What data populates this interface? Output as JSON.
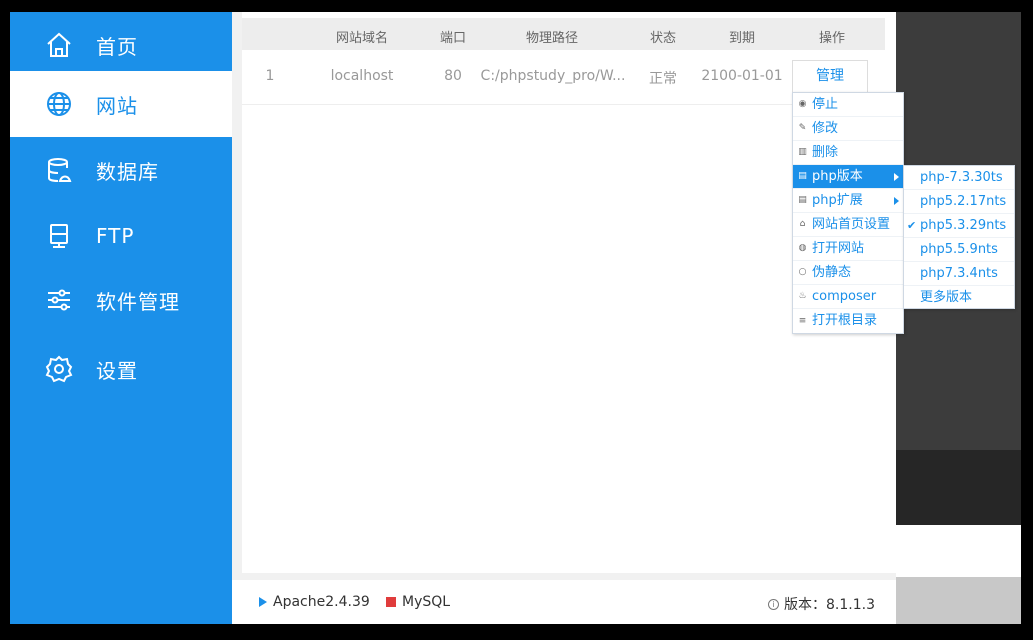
{
  "sidebar": {
    "items": [
      {
        "label": "首页",
        "icon": "home-icon"
      },
      {
        "label": "网站",
        "icon": "globe-icon",
        "active": true
      },
      {
        "label": "数据库",
        "icon": "database-icon"
      },
      {
        "label": "FTP",
        "icon": "ftp-icon"
      },
      {
        "label": "软件管理",
        "icon": "sliders-icon"
      },
      {
        "label": "设置",
        "icon": "gear-icon"
      }
    ]
  },
  "table": {
    "headers": [
      "网站域名",
      "端口",
      "物理路径",
      "状态",
      "到期",
      "操作"
    ],
    "rows": [
      {
        "index": "1",
        "domain": "localhost",
        "port": "80",
        "path": "C:/phpstudy_pro/W...",
        "status": "正常",
        "expiry": "2100-01-01",
        "action": "管理"
      }
    ]
  },
  "context_menu": {
    "items": [
      {
        "label": "停止",
        "icon": "stop-icon"
      },
      {
        "label": "修改",
        "icon": "edit-icon"
      },
      {
        "label": "删除",
        "icon": "trash-icon"
      },
      {
        "label": "php版本",
        "icon": "php-version-icon",
        "active": true,
        "has_submenu": true
      },
      {
        "label": "php扩展",
        "icon": "php-ext-icon",
        "has_submenu": true
      },
      {
        "label": "网站首页设置",
        "icon": "home-settings-icon"
      },
      {
        "label": "打开网站",
        "icon": "open-site-icon"
      },
      {
        "label": "伪静态",
        "icon": "rewrite-icon"
      },
      {
        "label": "composer",
        "icon": "composer-icon"
      },
      {
        "label": "打开根目录",
        "icon": "folder-list-icon"
      }
    ]
  },
  "php_versions": {
    "items": [
      {
        "label": "php-7.3.30ts",
        "checked": false
      },
      {
        "label": "php5.2.17nts",
        "checked": false
      },
      {
        "label": "php5.3.29nts",
        "checked": true
      },
      {
        "label": "php5.5.9nts",
        "checked": false
      },
      {
        "label": "php7.3.4nts",
        "checked": false
      },
      {
        "label": "更多版本",
        "checked": false
      }
    ]
  },
  "statusbar": {
    "apache": "Apache2.4.39",
    "mysql": "MySQL",
    "version_label": "版本：8.1.1.3"
  },
  "colors": {
    "accent": "#1b90e9",
    "mysql_stopped": "#e03c3c"
  }
}
